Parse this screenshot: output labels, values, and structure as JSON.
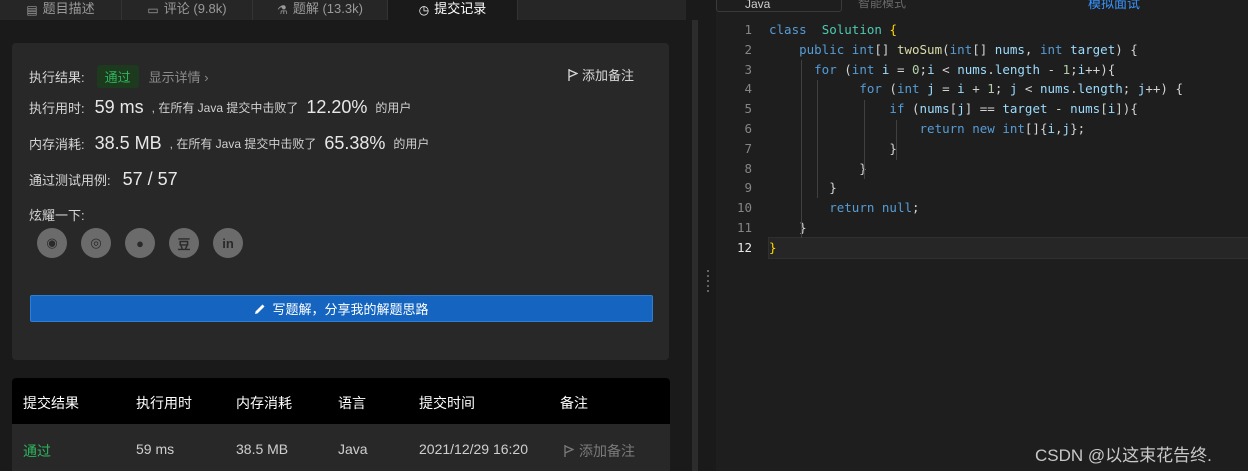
{
  "tabs": [
    {
      "label": "题目描述"
    },
    {
      "label": "评论 (9.8k)"
    },
    {
      "label": "题解 (13.3k)"
    },
    {
      "label": "提交记录"
    }
  ],
  "result": {
    "label": "执行结果:",
    "status": "通过",
    "details_link": "显示详情 ›",
    "add_note": "添加备注",
    "runtime": {
      "label": "执行用时:",
      "value": "59 ms",
      "mid": ", 在所有 Java 提交中击败了",
      "percent": "12.20%",
      "suffix": "的用户"
    },
    "memory": {
      "label": "内存消耗:",
      "value": "38.5 MB",
      "mid": ", 在所有 Java 提交中击败了",
      "percent": "65.38%",
      "suffix": "的用户"
    },
    "tests": {
      "label": "通过测试用例:",
      "value": "57 / 57"
    },
    "share_label": "炫耀一下:",
    "share_icons": [
      {
        "name": "wechat-icon",
        "glyph": "◉"
      },
      {
        "name": "weibo-icon",
        "glyph": "◎"
      },
      {
        "name": "qq-icon",
        "glyph": "●"
      },
      {
        "name": "douban-icon",
        "glyph": "豆"
      },
      {
        "name": "linkedin-icon",
        "glyph": "in"
      }
    ],
    "write_button": "写题解，分享我的解题思路"
  },
  "submissions": {
    "headers": [
      "提交结果",
      "执行用时",
      "内存消耗",
      "语言",
      "提交时间",
      "备注"
    ],
    "rows": [
      {
        "result": "通过",
        "time": "59 ms",
        "memory": "38.5 MB",
        "lang": "Java",
        "submitted": "2021/12/29 16:20",
        "note": "添加备注"
      }
    ]
  },
  "editor": {
    "language": "Java",
    "mode": "智能模式",
    "simulate": "模拟面试",
    "current_line": 12,
    "lines": [
      [
        [
          "kw",
          "class"
        ],
        [
          "",
          "  "
        ],
        [
          "ty",
          "Solution"
        ],
        [
          "",
          " "
        ],
        [
          "br",
          "{"
        ]
      ],
      [
        [
          "",
          "    "
        ],
        [
          "kw",
          "public"
        ],
        [
          "",
          " "
        ],
        [
          "kw",
          "int"
        ],
        [
          "",
          "[] "
        ],
        [
          "fn",
          "twoSum"
        ],
        [
          "",
          "("
        ],
        [
          "kw",
          "int"
        ],
        [
          "",
          "[] "
        ],
        [
          "va",
          "nums"
        ],
        [
          "",
          ", "
        ],
        [
          "kw",
          "int"
        ],
        [
          "",
          " "
        ],
        [
          "va",
          "target"
        ],
        [
          "",
          ") {"
        ]
      ],
      [
        [
          "",
          "      "
        ],
        [
          "kw",
          "for"
        ],
        [
          "",
          " ("
        ],
        [
          "kw",
          "int"
        ],
        [
          "",
          " "
        ],
        [
          "va",
          "i"
        ],
        [
          "",
          " = "
        ],
        [
          "nu",
          "0"
        ],
        [
          "",
          ";"
        ],
        [
          "va",
          "i"
        ],
        [
          "",
          " < "
        ],
        [
          "va",
          "nums"
        ],
        [
          "",
          "."
        ],
        [
          "va",
          "length"
        ],
        [
          "",
          " - "
        ],
        [
          "nu",
          "1"
        ],
        [
          "",
          ";"
        ],
        [
          "va",
          "i"
        ],
        [
          "",
          "++){"
        ]
      ],
      [
        [
          "",
          "            "
        ],
        [
          "kw",
          "for"
        ],
        [
          "",
          " ("
        ],
        [
          "kw",
          "int"
        ],
        [
          "",
          " "
        ],
        [
          "va",
          "j"
        ],
        [
          "",
          " = "
        ],
        [
          "va",
          "i"
        ],
        [
          "",
          " + "
        ],
        [
          "nu",
          "1"
        ],
        [
          "",
          "; "
        ],
        [
          "va",
          "j"
        ],
        [
          "",
          " < "
        ],
        [
          "va",
          "nums"
        ],
        [
          "",
          "."
        ],
        [
          "va",
          "length"
        ],
        [
          "",
          "; "
        ],
        [
          "va",
          "j"
        ],
        [
          "",
          "++) {"
        ]
      ],
      [
        [
          "",
          "                "
        ],
        [
          "kw",
          "if"
        ],
        [
          "",
          " ("
        ],
        [
          "va",
          "nums"
        ],
        [
          "",
          "["
        ],
        [
          "va",
          "j"
        ],
        [
          "",
          "] == "
        ],
        [
          "va",
          "target"
        ],
        [
          "",
          " - "
        ],
        [
          "va",
          "nums"
        ],
        [
          "",
          "["
        ],
        [
          "va",
          "i"
        ],
        [
          "",
          "]){"
        ]
      ],
      [
        [
          "",
          "                    "
        ],
        [
          "kw",
          "return"
        ],
        [
          "",
          " "
        ],
        [
          "kw",
          "new"
        ],
        [
          "",
          " "
        ],
        [
          "kw",
          "int"
        ],
        [
          "",
          "[]{"
        ],
        [
          "va",
          "i"
        ],
        [
          "",
          ","
        ],
        [
          "va",
          "j"
        ],
        [
          "",
          "};"
        ]
      ],
      [
        [
          "",
          "                }"
        ]
      ],
      [
        [
          "",
          "            }"
        ]
      ],
      [
        [
          "",
          "        }"
        ]
      ],
      [
        [
          "",
          "        "
        ],
        [
          "kw",
          "return"
        ],
        [
          "",
          " "
        ],
        [
          "kw",
          "null"
        ],
        [
          "",
          ";"
        ]
      ],
      [
        [
          "",
          "    }"
        ]
      ],
      [
        [
          "br",
          "}"
        ]
      ]
    ]
  },
  "watermark": "CSDN @以这束花告终."
}
